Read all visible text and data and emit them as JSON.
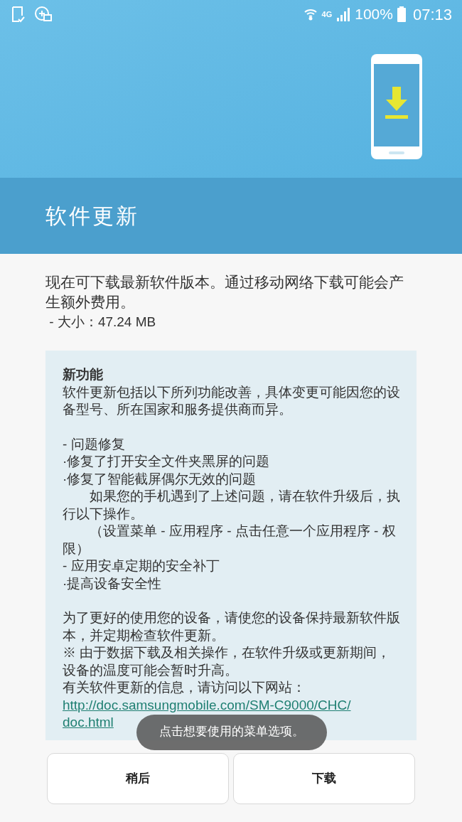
{
  "status_bar": {
    "network": "4G",
    "battery": "100%",
    "time": "07:13"
  },
  "title": "软件更新",
  "intro": "现在可下载最新软件版本。通过移动网络下载可能会产生额外费用。",
  "size": " - 大小：47.24 MB",
  "notes": {
    "heading": "新功能",
    "sections": [
      [
        {
          "kind": "line",
          "text": "软件更新包括以下所列功能改善，具体变更可能因您的设备型号、所在国家和服务提供商而异。"
        }
      ],
      [
        {
          "kind": "line",
          "text": "- 问题修复"
        },
        {
          "kind": "line",
          "text": "·修复了打开安全文件夹黑屏的问题"
        },
        {
          "kind": "line",
          "text": "·修复了智能截屏偶尔无效的问题"
        },
        {
          "kind": "indent",
          "text": "如果您的手机遇到了上述问题，请在软件升级后，执行以下操作。"
        },
        {
          "kind": "indent",
          "text": "（设置菜单 - 应用程序 - 点击任意一个应用程序 - 权限）"
        },
        {
          "kind": "line",
          "text": "- 应用安卓定期的安全补丁"
        },
        {
          "kind": "line",
          "text": "·提高设备安全性"
        }
      ],
      [
        {
          "kind": "line",
          "text": "为了更好的使用您的设备，请使您的设备保持最新软件版本，并定期检查软件更新。"
        },
        {
          "kind": "line",
          "text": "※ 由于数据下载及相关操作，在软件升级或更新期间，设备的温度可能会暂时升高。"
        },
        {
          "kind": "line",
          "text": "有关软件更新的信息，请访问以下网站："
        }
      ]
    ],
    "link": "http://doc.samsungmobile.com/SM-C9000/CHC/doc.html"
  },
  "toast": "点击想要使用的菜单选项。",
  "buttons": [
    "稍后",
    "下载"
  ]
}
